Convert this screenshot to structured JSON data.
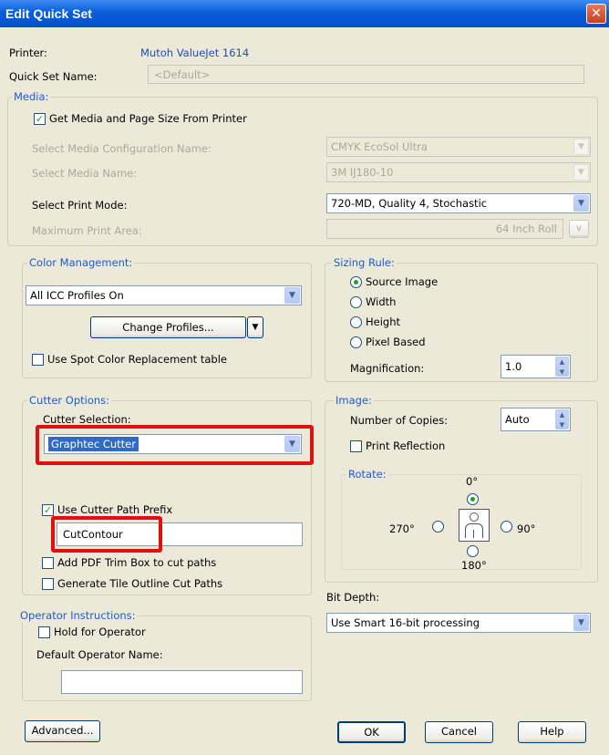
{
  "window": {
    "title": "Edit Quick Set",
    "close_glyph": "✕"
  },
  "printer": {
    "label": "Printer:",
    "value": "Mutoh ValueJet 1614"
  },
  "quick_set_name": {
    "label": "Quick Set Name:",
    "value": "<Default>"
  },
  "media": {
    "caption": "Media:",
    "get_from_printer": {
      "label": "Get Media and Page Size From Printer",
      "checked": true
    },
    "config_name": {
      "label": "Select Media Configuration Name:",
      "value": "CMYK EcoSol Ultra"
    },
    "media_name": {
      "label": "Select Media Name:",
      "value": "3M IJ180-10"
    },
    "print_mode": {
      "label": "Select Print Mode:",
      "value": "720-MD, Quality 4, Stochastic"
    },
    "max_area": {
      "label": "Maximum Print Area:",
      "value": "64 Inch Roll",
      "button": "v"
    }
  },
  "color_management": {
    "caption": "Color Management:",
    "profiles": "All ICC Profiles On",
    "change_profiles_button": "Change Profiles...",
    "spot_color": {
      "label": "Use Spot Color Replacement table",
      "checked": false
    }
  },
  "sizing_rule": {
    "caption": "Sizing Rule:",
    "options": [
      "Source Image",
      "Width",
      "Height",
      "Pixel Based"
    ],
    "selected": "Source Image",
    "magnification": {
      "label": "Magnification:",
      "value": "1.0"
    }
  },
  "cutter_options": {
    "caption": "Cutter Options:",
    "selection_label": "Cutter Selection:",
    "selection_value": "Graphtec Cutter",
    "use_prefix": {
      "label": "Use Cutter Path Prefix",
      "checked": true
    },
    "prefix_value": "CutContour",
    "pdf_trim": {
      "label": "Add PDF Trim Box to cut paths",
      "checked": false
    },
    "tile_outline": {
      "label": "Generate Tile Outline Cut Paths",
      "checked": false
    }
  },
  "image": {
    "caption": "Image:",
    "copies": {
      "label": "Number of Copies:",
      "value": "Auto"
    },
    "print_reflection": {
      "label": "Print Reflection",
      "checked": false
    },
    "rotate": {
      "caption": "Rotate:",
      "deg0": "0°",
      "deg90": "90°",
      "deg180": "180°",
      "deg270": "270°",
      "selected": "0°"
    }
  },
  "bit_depth": {
    "label": "Bit Depth:",
    "value": "Use Smart 16-bit processing"
  },
  "operator": {
    "caption": "Operator Instructions:",
    "hold": {
      "label": "Hold for Operator",
      "checked": false
    },
    "default_name_label": "Default Operator Name:",
    "default_name_value": ""
  },
  "buttons": {
    "advanced": "Advanced...",
    "ok": "OK",
    "cancel": "Cancel",
    "help": "Help"
  },
  "colors": {
    "highlight": "#e01010",
    "accent": "#1c5bd0",
    "selection": "#316ac5"
  }
}
